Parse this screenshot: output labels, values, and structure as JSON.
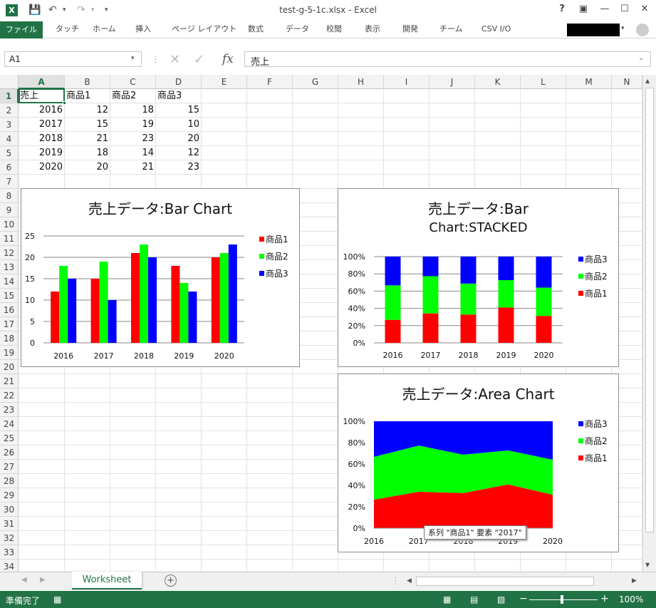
{
  "window": {
    "title": "test-g-5-1c.xlsx - Excel",
    "help": "?",
    "app_icon": "excel-icon"
  },
  "ribbon": {
    "file": "ファイル",
    "tabs": [
      "タッチ",
      "ホーム",
      "挿入",
      "ページ レイアウト",
      "数式",
      "データ",
      "校閲",
      "表示",
      "開発",
      "チーム",
      "CSV I/O"
    ]
  },
  "formula_bar": {
    "name_box": "A1",
    "fx": "fx",
    "content": "売上"
  },
  "columns": [
    "A",
    "B",
    "C",
    "D",
    "E",
    "F",
    "G",
    "H",
    "I",
    "J",
    "K",
    "L",
    "M",
    "N"
  ],
  "rows": [
    "1",
    "2",
    "3",
    "4",
    "5",
    "6",
    "7",
    "8",
    "9",
    "10",
    "11",
    "12",
    "13",
    "14",
    "15",
    "16",
    "17",
    "18",
    "19",
    "20",
    "21",
    "22",
    "23",
    "24",
    "25",
    "26",
    "27",
    "28",
    "29",
    "30",
    "31",
    "32",
    "33",
    "34"
  ],
  "table": {
    "header": [
      "売上",
      "商品1",
      "商品2",
      "商品3"
    ],
    "data": [
      [
        "2016",
        "12",
        "18",
        "15"
      ],
      [
        "2017",
        "15",
        "19",
        "10"
      ],
      [
        "2018",
        "21",
        "23",
        "20"
      ],
      [
        "2019",
        "18",
        "14",
        "12"
      ],
      [
        "2020",
        "20",
        "21",
        "23"
      ]
    ]
  },
  "chart_data": [
    {
      "type": "bar",
      "title": "売上データ:Bar Chart",
      "categories": [
        "2016",
        "2017",
        "2018",
        "2019",
        "2020"
      ],
      "series": [
        {
          "name": "商品1",
          "values": [
            12,
            15,
            21,
            18,
            20
          ]
        },
        {
          "name": "商品2",
          "values": [
            18,
            19,
            23,
            14,
            21
          ]
        },
        {
          "name": "商品3",
          "values": [
            15,
            10,
            20,
            12,
            23
          ]
        }
      ],
      "ylim": [
        0,
        25
      ],
      "yticks": [
        "0",
        "5",
        "10",
        "15",
        "20",
        "25"
      ],
      "legend": "right",
      "grid": true
    },
    {
      "type": "bar",
      "stacked": "percent",
      "title_lines": [
        "売上データ:Bar",
        "Chart:STACKED"
      ],
      "categories": [
        "2016",
        "2017",
        "2018",
        "2019",
        "2020"
      ],
      "series": [
        {
          "name": "商品1",
          "values": [
            12,
            15,
            21,
            18,
            20
          ]
        },
        {
          "name": "商品2",
          "values": [
            18,
            19,
            23,
            14,
            21
          ]
        },
        {
          "name": "商品3",
          "values": [
            15,
            10,
            20,
            12,
            23
          ]
        }
      ],
      "yticks": [
        "0%",
        "20%",
        "40%",
        "60%",
        "80%",
        "100%"
      ],
      "legend": "right",
      "grid": true
    },
    {
      "type": "area",
      "stacked": "percent",
      "title": "売上データ:Area Chart",
      "categories": [
        "2016",
        "2017",
        "2018",
        "2019",
        "2020"
      ],
      "series": [
        {
          "name": "商品1",
          "values": [
            12,
            15,
            21,
            18,
            20
          ]
        },
        {
          "name": "商品2",
          "values": [
            18,
            19,
            23,
            14,
            21
          ]
        },
        {
          "name": "商品3",
          "values": [
            15,
            10,
            20,
            12,
            23
          ]
        }
      ],
      "yticks": [
        "0%",
        "20%",
        "40%",
        "60%",
        "80%",
        "100%"
      ],
      "legend": "right",
      "tooltip": "系列 \"商品1\" 要素 \"2017\""
    }
  ],
  "colors": {
    "s1": "#ff0000",
    "s2": "#00ff00",
    "s3": "#0000ff",
    "accent": "#217346"
  },
  "sheet_tabs": {
    "active": "Worksheet",
    "add": "+"
  },
  "status": {
    "ready": "準備完了",
    "zoom": "100%",
    "minus": "−",
    "plus": "+"
  }
}
